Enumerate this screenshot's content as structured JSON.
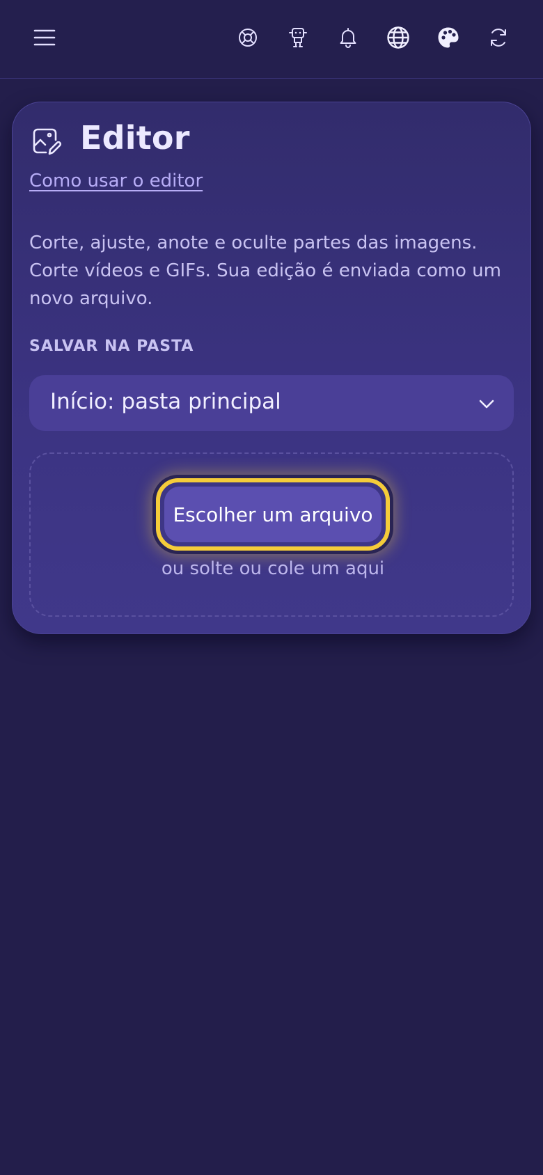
{
  "topbar": {
    "menu_icon": "hamburger-menu-icon",
    "icons": [
      {
        "name": "help-lifebuoy-icon"
      },
      {
        "name": "robot-icon"
      },
      {
        "name": "bell-icon"
      },
      {
        "name": "globe-icon"
      },
      {
        "name": "palette-icon"
      },
      {
        "name": "refresh-icon"
      }
    ]
  },
  "card": {
    "icon": "image-edit-icon",
    "title": "Editor",
    "help_link": "Como usar o editor",
    "description": "Corte, ajuste, anote e oculte partes das imagens. Corte vídeos e GIFs. Sua edição é enviada como um novo arquivo.",
    "folder_label": "SALVAR NA PASTA",
    "folder_value": "Início: pasta principal",
    "choose_button": "Escolher um arquivo",
    "drop_hint": "ou solte ou cole um aqui"
  },
  "colors": {
    "background": "#231e4b",
    "card": "#3b3381",
    "accent_focus": "#f5cc3a",
    "button": "#5b4fb0",
    "select": "#4a3f97"
  }
}
